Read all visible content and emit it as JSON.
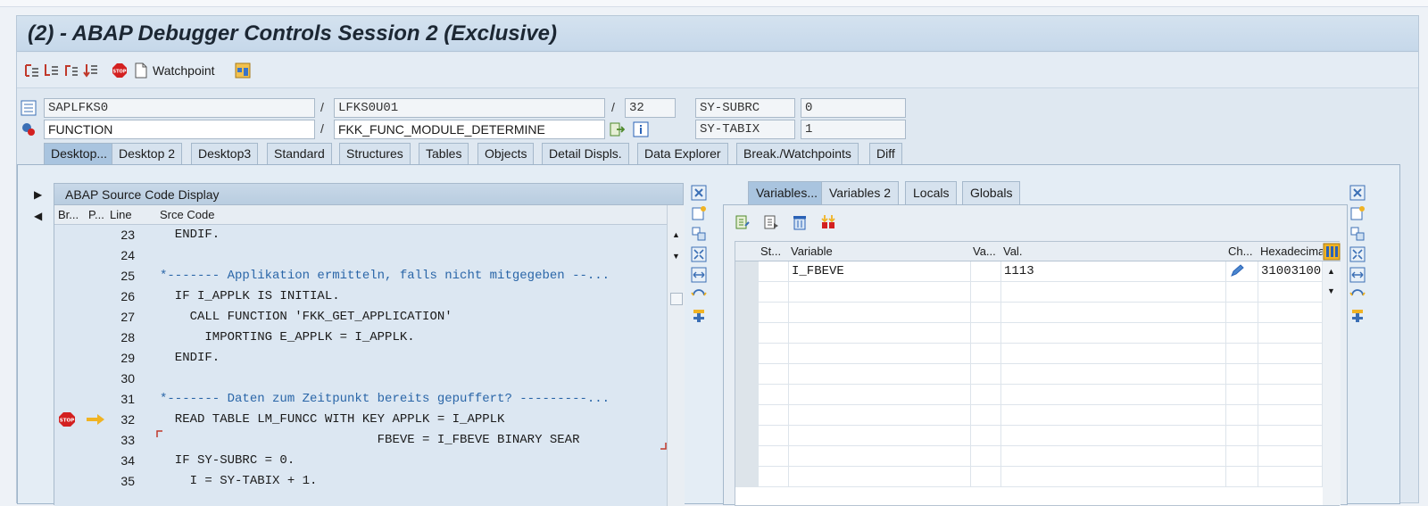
{
  "window": {
    "title": "(2) - ABAP Debugger Controls Session 2 (Exclusive)"
  },
  "toolbar": {
    "icons": [
      "step-into-icon",
      "step-over-icon",
      "return-icon",
      "continue-icon",
      "stop-icon"
    ],
    "watchpoint_label": "Watchpoint"
  },
  "context": {
    "program": "SAPLFKS0",
    "include": "LFKS0U01",
    "line": "32",
    "sy_subrc_label": "SY-SUBRC",
    "sy_subrc_value": "0",
    "event_type": "FUNCTION",
    "event_name": "FKK_FUNC_MODULE_DETERMINE",
    "sy_tabix_label": "SY-TABIX",
    "sy_tabix_value": "1"
  },
  "tabs": [
    "Desktop...",
    "Desktop 2",
    "Desktop3",
    "Standard",
    "Structures",
    "Tables",
    "Objects",
    "Detail Displs.",
    "Data Explorer",
    "Break./Watchpoints",
    "Diff"
  ],
  "source": {
    "title": "ABAP Source Code Display",
    "columns": {
      "br": "Br...",
      "p": "P...",
      "line": "Line",
      "code": "Srce Code"
    },
    "lines": [
      {
        "no": "23",
        "code": "  ENDIF."
      },
      {
        "no": "24",
        "code": ""
      },
      {
        "no": "25",
        "code": "*------- Applikation ermitteln, falls nicht mitgegeben --..."
      },
      {
        "no": "26",
        "code": "  IF I_APPLK IS INITIAL."
      },
      {
        "no": "27",
        "code": "    CALL FUNCTION 'FKK_GET_APPLICATION'"
      },
      {
        "no": "28",
        "code": "      IMPORTING E_APPLK = I_APPLK."
      },
      {
        "no": "29",
        "code": "  ENDIF."
      },
      {
        "no": "30",
        "code": ""
      },
      {
        "no": "31",
        "code": "*------- Daten zum Zeitpunkt bereits gepuffert? ---------..."
      },
      {
        "no": "32",
        "code": "  READ TABLE LM_FUNCC WITH KEY APPLK = I_APPLK"
      },
      {
        "no": "33",
        "code": "                             FBEVE = I_FBEVE BINARY SEAR"
      },
      {
        "no": "34",
        "code": "  IF SY-SUBRC = 0."
      },
      {
        "no": "35",
        "code": "    I = SY-TABIX + 1."
      }
    ]
  },
  "variables": {
    "tabs": [
      "Variables...",
      "Variables 2",
      "Locals",
      "Globals"
    ],
    "columns": {
      "st": "St...",
      "variable": "Variable",
      "va": "Va...",
      "val": "Val.",
      "ch": "Ch...",
      "hex": "Hexadecimal"
    },
    "rows": [
      {
        "variable": "I_FBEVE",
        "val": "1113",
        "hex": "31003100"
      }
    ]
  }
}
